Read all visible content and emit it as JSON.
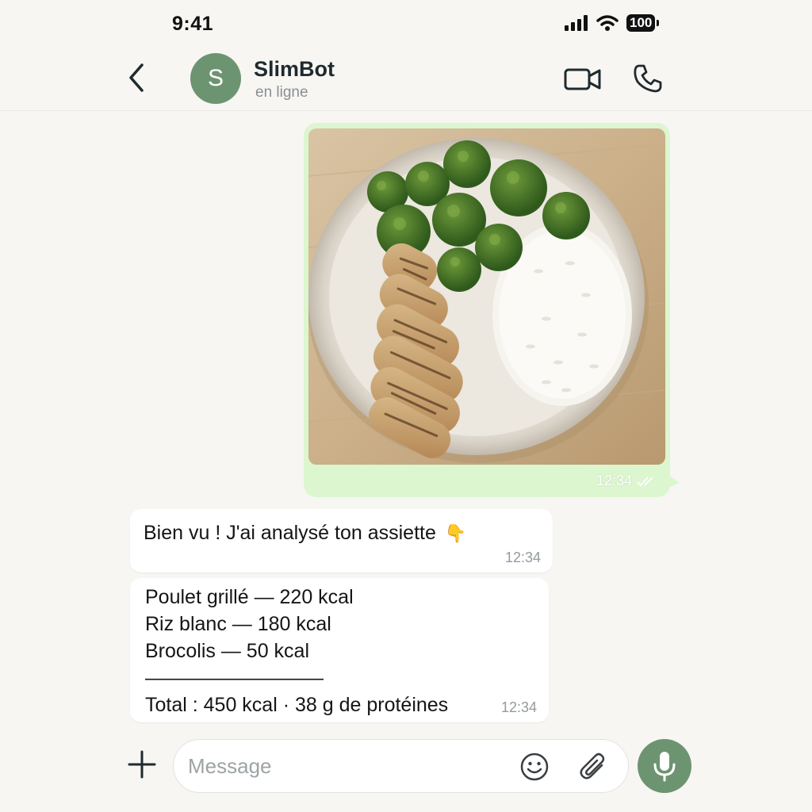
{
  "status_bar": {
    "time": "9:41",
    "battery": "100"
  },
  "header": {
    "avatar_letter": "S",
    "name": "SlimBot",
    "status": "en ligne"
  },
  "messages": {
    "photo": {
      "time": "12:34"
    },
    "greeting": {
      "text": "Bien vu ! J'ai analysé ton assiette",
      "emoji": "👇",
      "time": "12:34"
    },
    "analysis": {
      "lines": [
        "Poulet grillé — 220 kcal",
        "Riz blanc — 180 kcal",
        "Brocolis — 50 kcal",
        "—————————",
        "Total : 450 kcal · 38 g de protéines"
      ],
      "time": "12:34"
    }
  },
  "composer": {
    "placeholder": "Message"
  },
  "colors": {
    "accent": "#6d9470",
    "outgoing_bubble": "#dcf6cf",
    "background": "#f7f6f3"
  },
  "icons": [
    "back-icon",
    "video-call-icon",
    "phone-icon",
    "plus-icon",
    "emoji-icon",
    "paperclip-icon",
    "microphone-icon"
  ]
}
